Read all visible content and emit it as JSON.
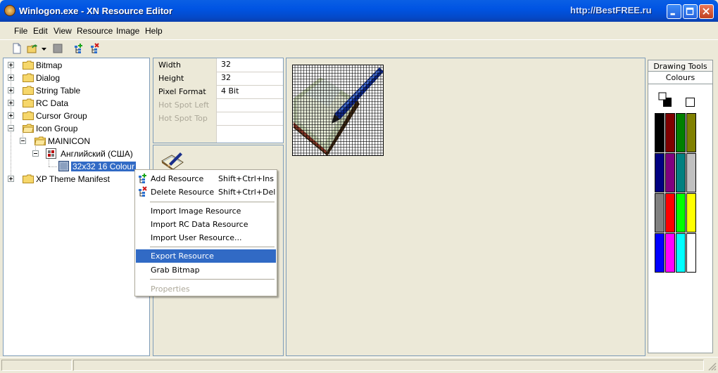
{
  "window": {
    "title": "Winlogon.exe - XN Resource Editor",
    "watermark": "http://BestFREE.ru"
  },
  "menubar": {
    "items": [
      "File",
      "Edit",
      "View",
      "Resource",
      "Image",
      "Help"
    ]
  },
  "toolbar": {
    "buttons": [
      "new-file-icon",
      "open-folder-icon",
      "dropdown-arrow-icon",
      "save-icon",
      "add-resource-icon",
      "delete-resource-icon"
    ]
  },
  "tree": {
    "nodes": [
      {
        "label": "Bitmap",
        "expanded": false
      },
      {
        "label": "Dialog",
        "expanded": false
      },
      {
        "label": "String Table",
        "expanded": false
      },
      {
        "label": "RC Data",
        "expanded": false
      },
      {
        "label": "Cursor Group",
        "expanded": false
      },
      {
        "label": "Icon Group",
        "expanded": true
      },
      {
        "label": "MAINICON",
        "expanded": true
      },
      {
        "label": "Английский (США)",
        "expanded": true
      },
      {
        "label": "32x32 16 Colour",
        "selected": true
      },
      {
        "label": "XP Theme Manifest",
        "expanded": false
      }
    ]
  },
  "properties": {
    "rows": [
      {
        "name": "Width",
        "value": "32",
        "enabled": true
      },
      {
        "name": "Height",
        "value": "32",
        "enabled": true
      },
      {
        "name": "Pixel Format",
        "value": "4 Bit",
        "enabled": true
      },
      {
        "name": "Hot Spot Left",
        "value": "",
        "enabled": false
      },
      {
        "name": "Hot Spot Top",
        "value": "",
        "enabled": false
      }
    ]
  },
  "tools": {
    "tabs": [
      "Drawing Tools",
      "Colours"
    ],
    "active_tab": "Colours",
    "palette": [
      "#000000",
      "#800000",
      "#008000",
      "#808000",
      "#000080",
      "#800080",
      "#008080",
      "#C0C0C0",
      "#808080",
      "#FF0000",
      "#00FF00",
      "#FFFF00",
      "#0000FF",
      "#FF00FF",
      "#00FFFF",
      "#FFFFFF"
    ]
  },
  "context_menu": {
    "items": [
      {
        "label": "Add Resource",
        "shortcut": "Shift+Ctrl+Ins",
        "icon": "add-resource-icon"
      },
      {
        "label": "Delete Resource",
        "shortcut": "Shift+Ctrl+Del",
        "icon": "delete-resource-icon"
      },
      {
        "label": "Import Image Resource"
      },
      {
        "label": "Import RC Data Resource"
      },
      {
        "label": "Import User Resource..."
      },
      {
        "label": "Export Resource",
        "highlighted": true
      },
      {
        "label": "Grab Bitmap"
      },
      {
        "label": "Properties",
        "disabled": true
      }
    ]
  }
}
